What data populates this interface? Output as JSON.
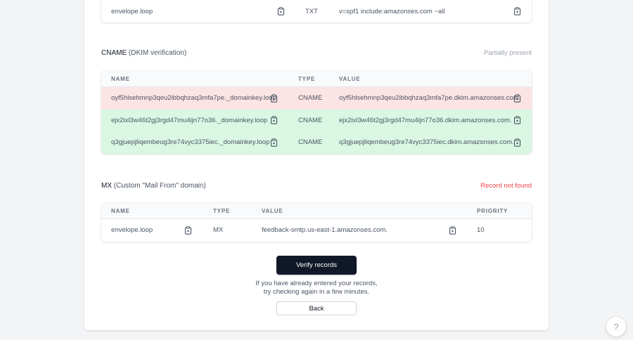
{
  "colors": {
    "status_partial": "#9ca3af",
    "status_missing": "#ef4444",
    "row_error": "#fde4e4",
    "row_ok": "#d9f7e3",
    "primary_button": "#111827"
  },
  "txt_row": {
    "name": "envelope.loop",
    "type": "TXT",
    "value": "v=spf1 include:amazonses.com ~all"
  },
  "cname_section": {
    "title": "CNAME",
    "subtitle": "(DKIM verification)",
    "status": "Partially present",
    "headers": {
      "name": "NAME",
      "type": "TYPE",
      "value": "VALUE"
    },
    "rows": [
      {
        "name": "oyf5hlsehmnp3qeu2ibbqhzaq3mfa7pe._domainkey.loop",
        "type": "CNAME",
        "value": "oyf5hlsehmnp3qeu2ibbqhzaq3mfa7pe.dkim.amazonses.com.",
        "state": "missing"
      },
      {
        "name": "ejx2ixl3w46t2gj3rgd47mu4ijn77o36._domainkey.loop",
        "type": "CNAME",
        "value": "ejx2ixl3w46t2gj3rgd47mu4ijn77o36.dkim.amazonses.com.",
        "state": "found"
      },
      {
        "name": "q3gjuepjliqembeug3re74vyc3375iec._domainkey.loop",
        "type": "CNAME",
        "value": "q3gjuepjliqembeug3re74vyc3375iec.dkim.amazonses.com.",
        "state": "found"
      }
    ]
  },
  "mx_section": {
    "title": "MX",
    "subtitle": "(Custom \"Mail From\" domain)",
    "status": "Record not found",
    "headers": {
      "name": "NAME",
      "type": "TYPE",
      "value": "VALUE",
      "priority": "PRIORITY"
    },
    "row": {
      "name": "envelope.loop",
      "type": "MX",
      "value": "feedback-smtp.us-east-1.amazonses.com.",
      "priority": "10"
    }
  },
  "actions": {
    "verify_label": "Verify records",
    "hint_line1": "If you have already entered your records,",
    "hint_line2": "try checking again in a few minutes.",
    "back_label": "Back"
  },
  "help": {
    "icon": "question-mark-icon",
    "label": "?"
  }
}
